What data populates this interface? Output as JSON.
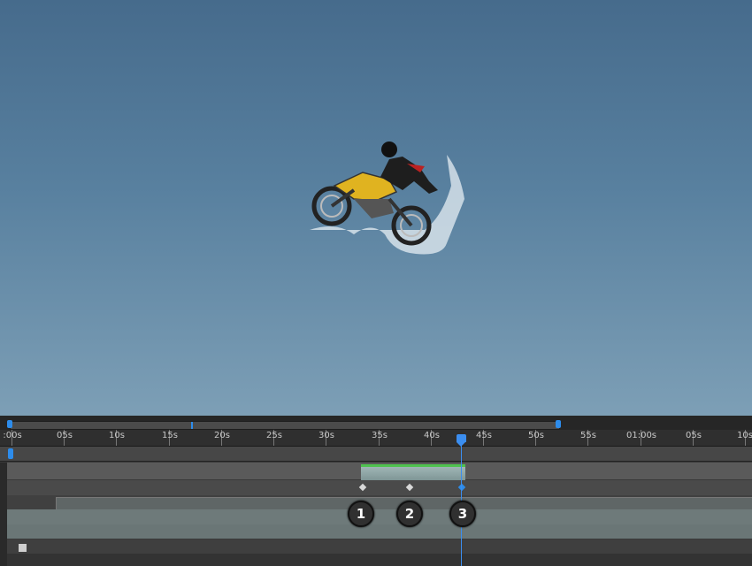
{
  "viewer": {
    "subject_icon": "motocross-rider-icon"
  },
  "timeline": {
    "ruler_labels": [
      ":00s",
      "05s",
      "10s",
      "15s",
      "20s",
      "25s",
      "30s",
      "35s",
      "40s",
      "45s",
      "50s",
      "55s",
      "01:00s",
      "05s",
      "10s"
    ],
    "callouts": [
      "1",
      "2",
      "3"
    ],
    "colors": {
      "accent": "#2d8ceb",
      "clip_top": "#4fc24f",
      "clip_fill": "#8ea6a6"
    }
  }
}
